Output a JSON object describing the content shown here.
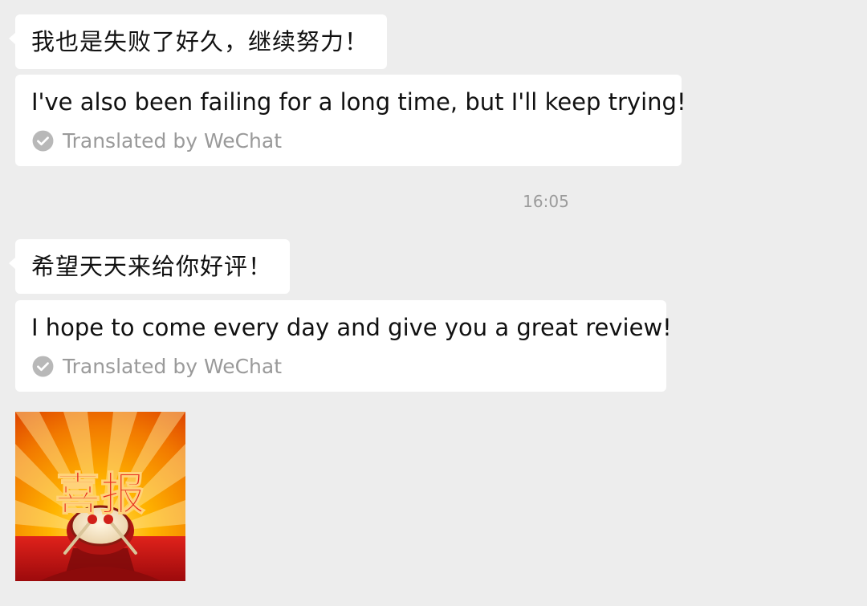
{
  "messages": [
    {
      "text": "我也是失败了好久，继续努力！",
      "translation": "I've also been failing for a long time, but I'll keep trying!",
      "translated_by": "Translated by WeChat"
    },
    {
      "text": "希望天天来给你好评！",
      "translation": "I hope to come every day and give you a great review!",
      "translated_by": "Translated by WeChat"
    }
  ],
  "timestamp": "16:05",
  "sticker": {
    "text": "喜报",
    "icon": "drum-icon",
    "colors": {
      "sky": "#ff9a00",
      "text": "#e8281c",
      "floor": "#c80f12"
    }
  },
  "colors": {
    "background": "#ededed",
    "bubble": "#ffffff",
    "muted_text": "#9a9a9a",
    "check_icon": "#b8b8b8"
  }
}
